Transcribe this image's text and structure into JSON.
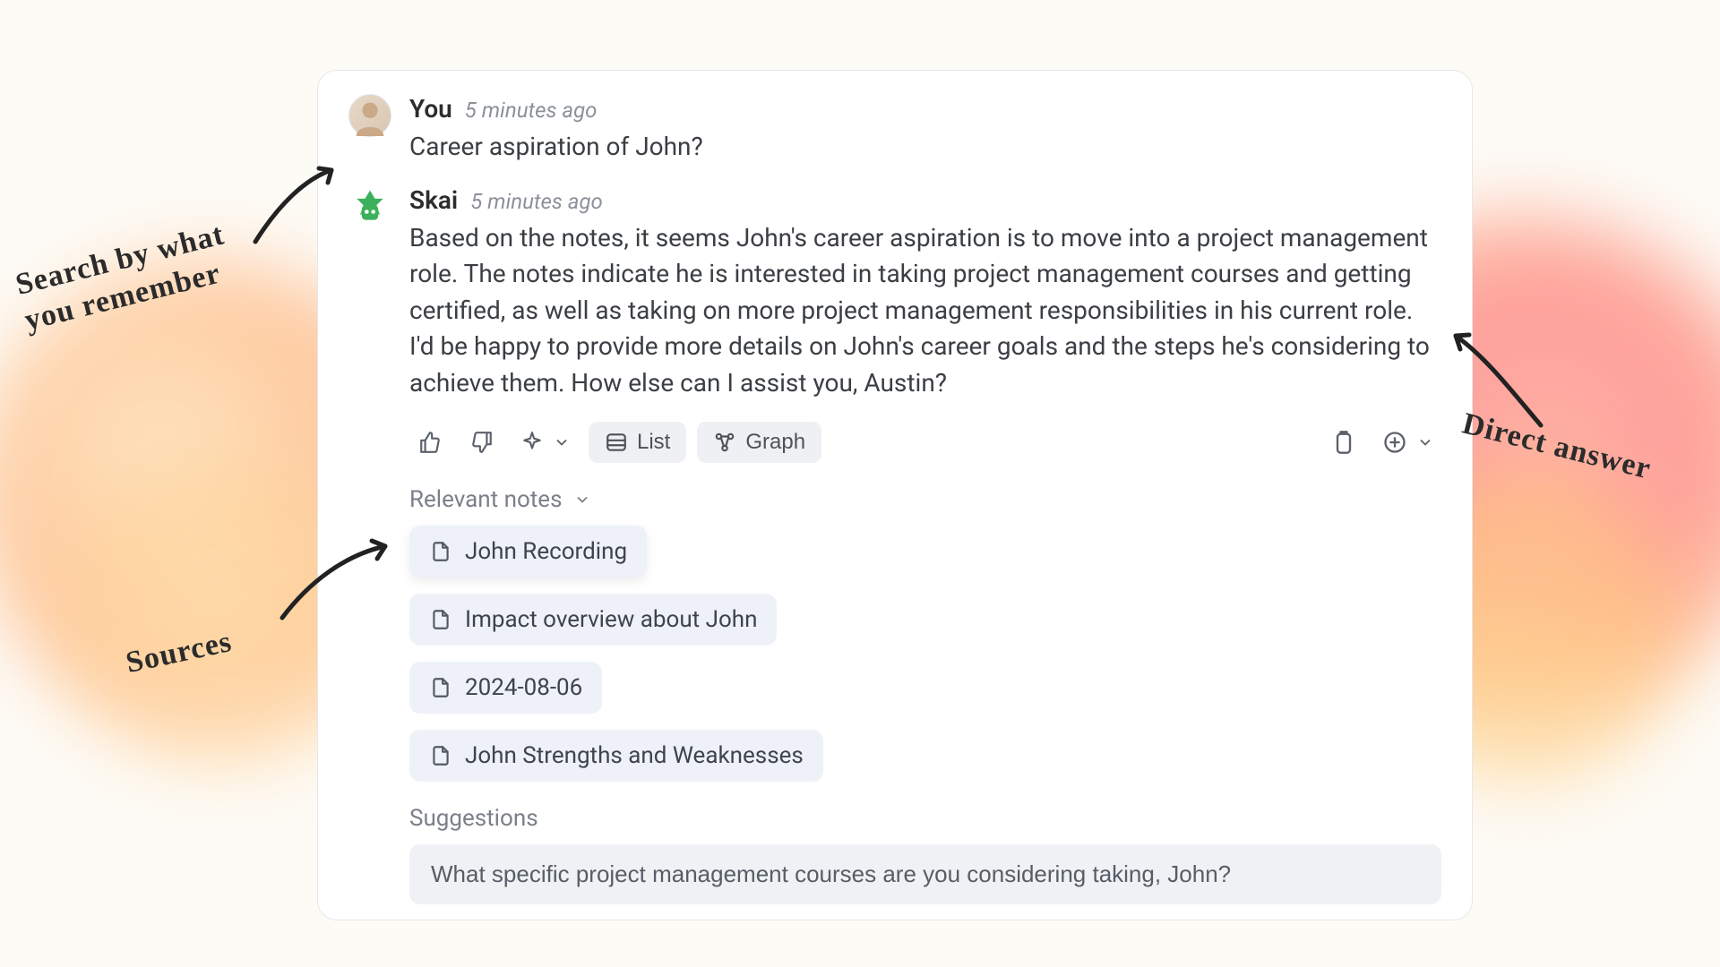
{
  "annotations": {
    "search_line1": "Search by what",
    "search_line2": "you remember",
    "direct": "Direct answer",
    "sources": "Sources"
  },
  "messages": {
    "user": {
      "author": "You",
      "time": "5 minutes ago",
      "text": "Career aspiration of John?"
    },
    "bot": {
      "author": "Skai",
      "time": "5 minutes ago",
      "text": "Based on the notes, it seems John's career aspiration is to move into a project management role. The notes indicate he is interested in taking project management courses and getting certified, as well as taking on more project management responsibilities in his current role. I'd be happy to provide more details on John's career goals and the steps he's considering to achieve them. How else can I assist you, Austin?"
    }
  },
  "toolbar": {
    "list_label": "List",
    "graph_label": "Graph"
  },
  "relevant_notes": {
    "label": "Relevant notes",
    "items": [
      "John Recording",
      "Impact overview about John",
      "2024-08-06",
      "John Strengths and Weaknesses"
    ]
  },
  "suggestions": {
    "label": "Suggestions",
    "items": [
      "What specific project management courses are you considering taking, John?"
    ]
  }
}
